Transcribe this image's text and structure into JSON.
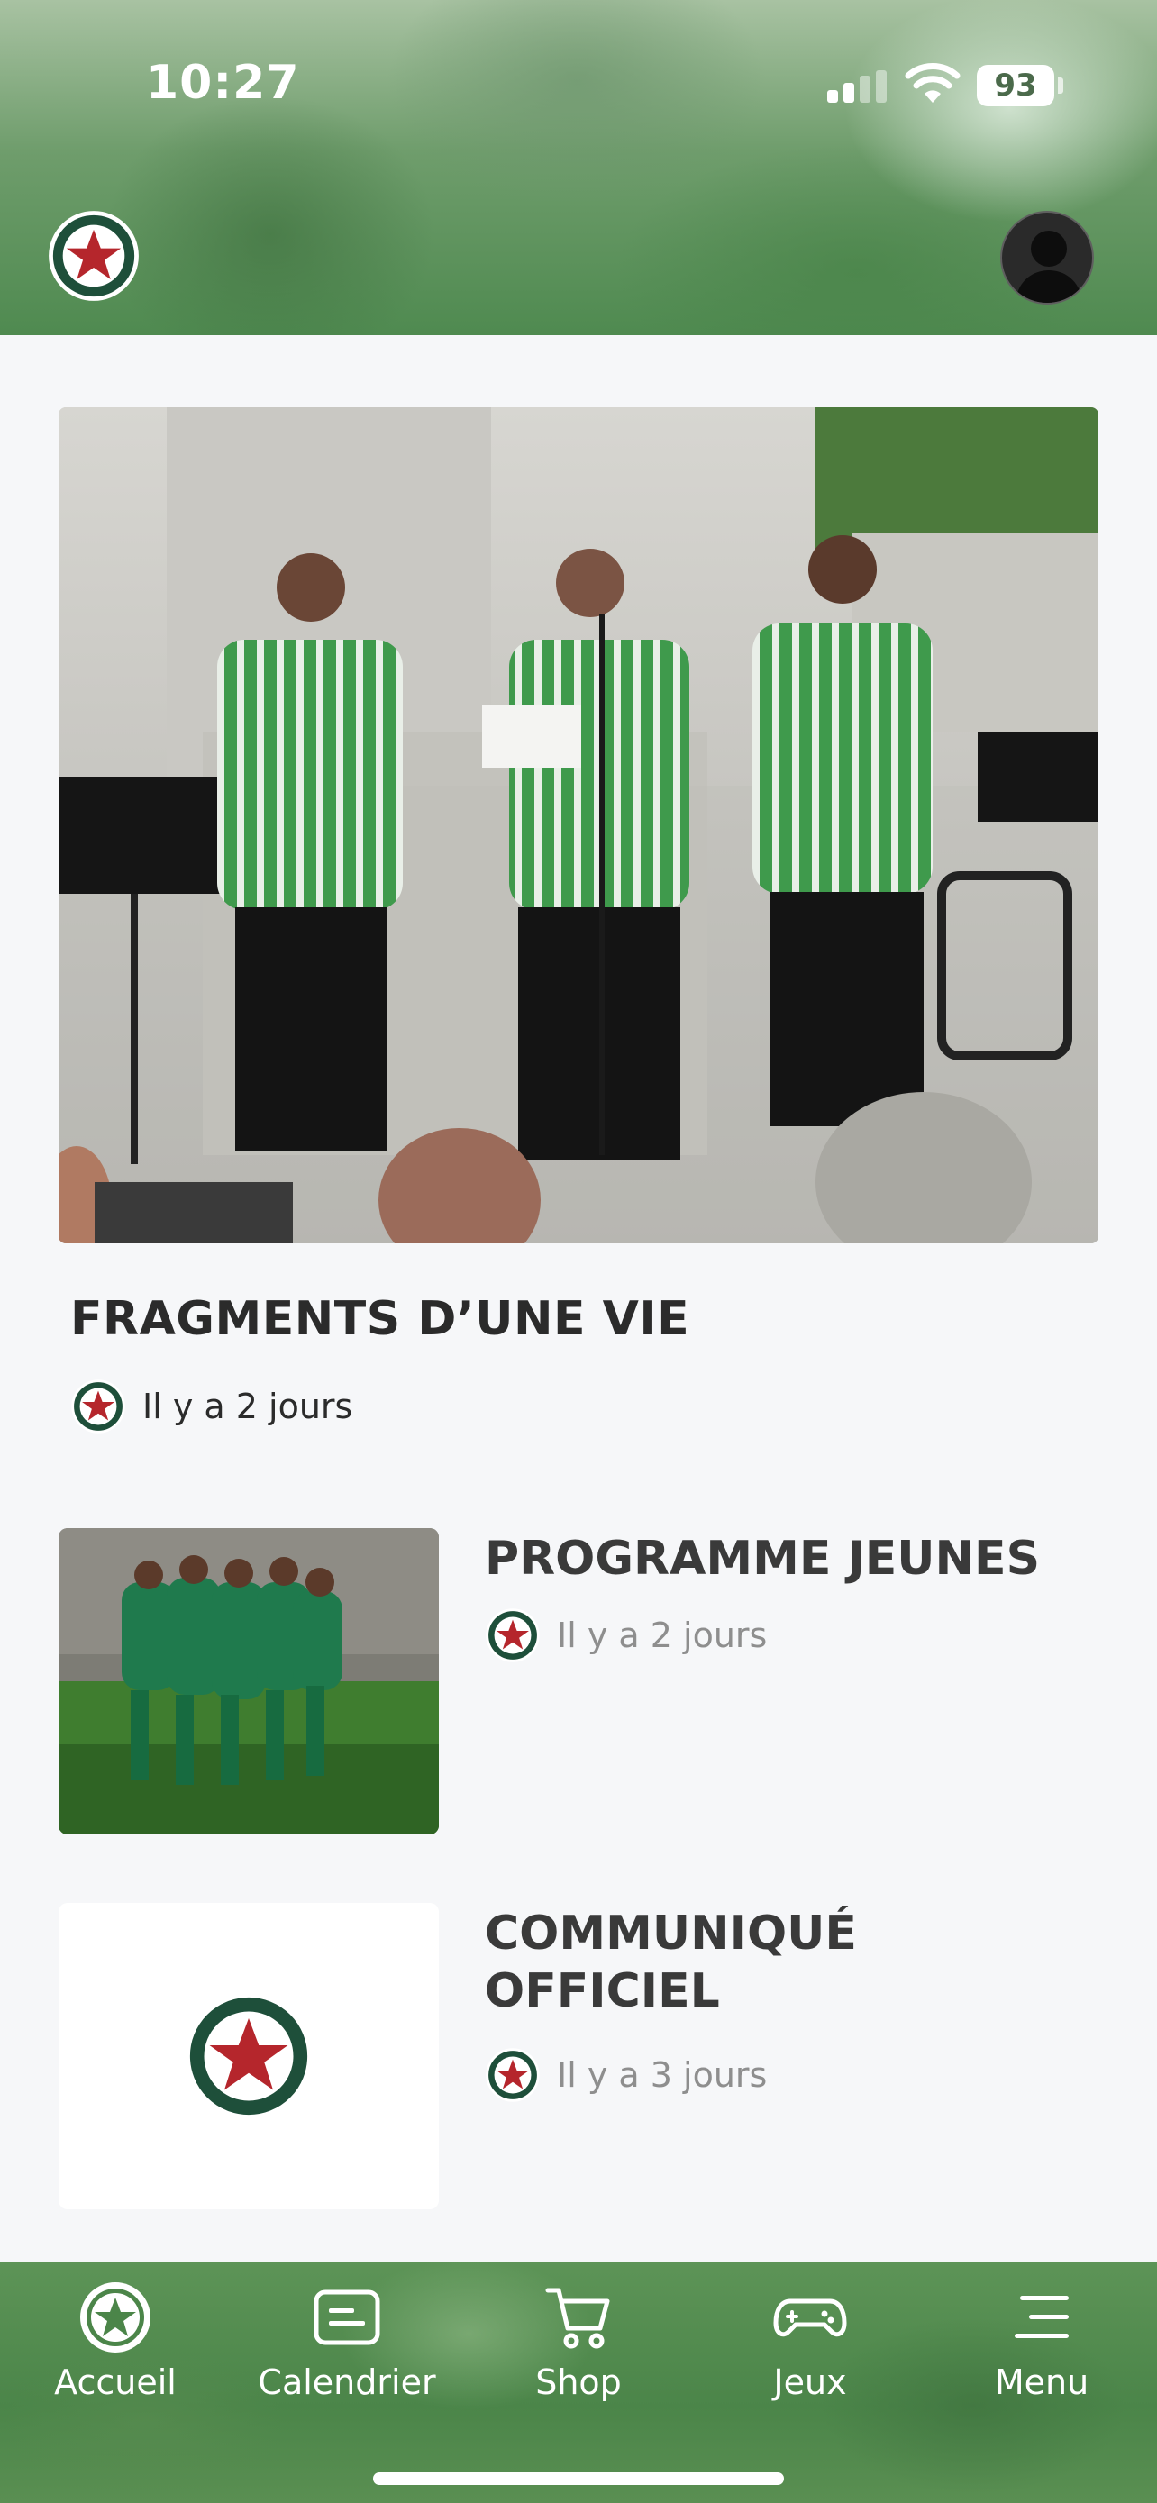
{
  "status_bar": {
    "time": "10:27",
    "battery": "93"
  },
  "featured": {
    "title": "FRAGMENTS D’UNE VIE",
    "time_ago": "Il y a 2 jours"
  },
  "articles": [
    {
      "title": "PROGRAMME JEUNES",
      "time_ago": "Il y a 2 jours"
    },
    {
      "title": "COMMUNIQUÉ OFFICIEL",
      "time_ago": "Il y a 3 jours"
    }
  ],
  "tabbar": {
    "items": [
      {
        "label": "Accueil",
        "icon": "home-star-icon"
      },
      {
        "label": "Calendrier",
        "icon": "calendar-icon"
      },
      {
        "label": "Shop",
        "icon": "cart-icon"
      },
      {
        "label": "Jeux",
        "icon": "gamepad-icon"
      },
      {
        "label": "Menu",
        "icon": "menu-icon"
      }
    ]
  },
  "colors": {
    "brand_green": "#1f5b3f",
    "brand_red": "#c1272d",
    "tabbar_green": "#4b8549",
    "background": "#f6f7f9",
    "meta_grey": "#8e8e8e"
  }
}
